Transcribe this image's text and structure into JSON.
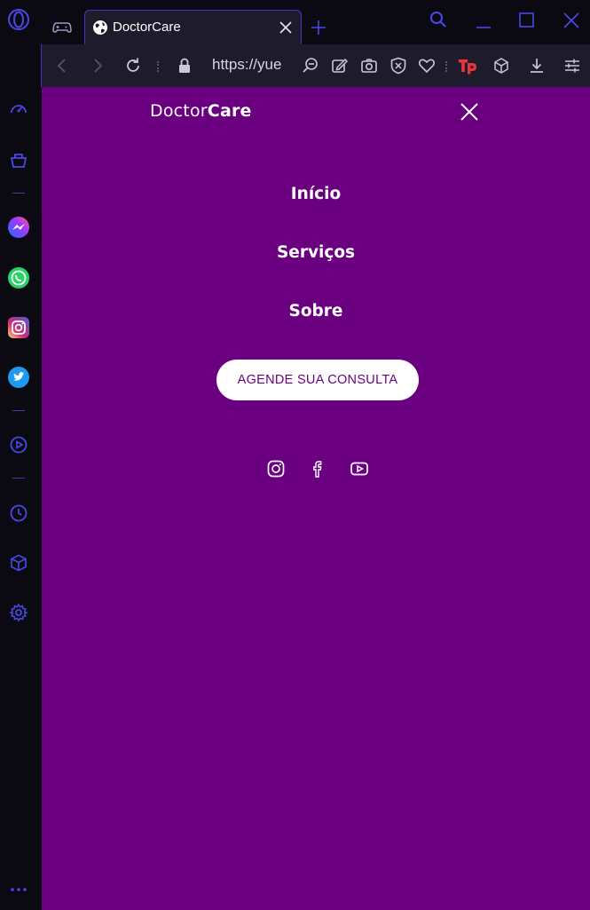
{
  "browser": {
    "tab": {
      "title": "DoctorCare"
    },
    "address_bar": {
      "url": "https://yue"
    },
    "sidebar": {
      "items": [
        {
          "name": "opera-logo-icon"
        },
        {
          "name": "speed-dial-icon"
        },
        {
          "name": "shopping-icon"
        },
        {
          "name": "messenger-icon"
        },
        {
          "name": "whatsapp-icon"
        },
        {
          "name": "instagram-icon"
        },
        {
          "name": "twitter-icon"
        },
        {
          "name": "player-icon"
        },
        {
          "name": "history-icon"
        },
        {
          "name": "extensions-icon"
        },
        {
          "name": "settings-icon"
        },
        {
          "name": "more-icon"
        }
      ]
    },
    "colors": {
      "accent": "#3d39c7",
      "chrome_bg": "#0b0a12",
      "toolbar_bg": "#1d1b2c"
    }
  },
  "page": {
    "brand": {
      "part1": "Doctor",
      "part2": "Care"
    },
    "nav": [
      {
        "label": "Início"
      },
      {
        "label": "Serviços"
      },
      {
        "label": "Sobre"
      }
    ],
    "cta": {
      "label": "AGENDE SUA CONSULTA"
    },
    "social": [
      "instagram-icon",
      "facebook-icon",
      "youtube-icon"
    ],
    "colors": {
      "background": "#6a007f",
      "text": "#ffffff",
      "cta_text": "#6a007f"
    }
  }
}
